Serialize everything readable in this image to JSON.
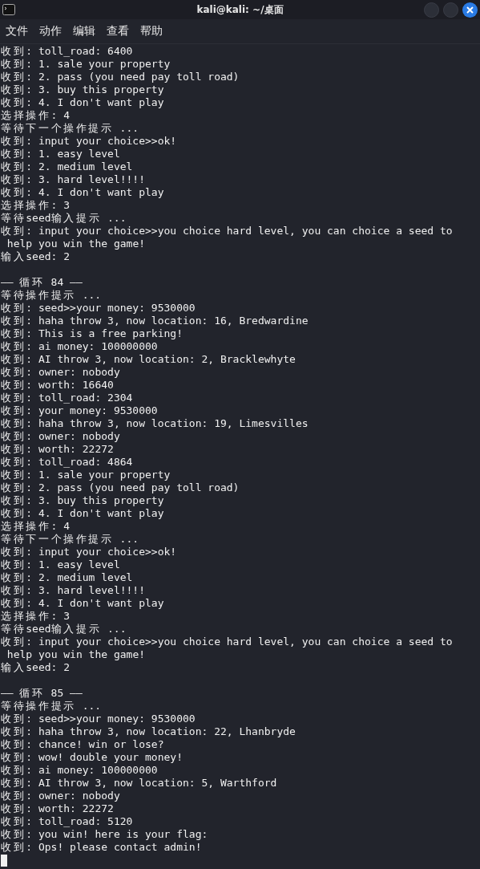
{
  "window": {
    "title": "kali@kali: ~/桌面"
  },
  "menu": [
    "文件",
    "动作",
    "编辑",
    "查看",
    "帮助"
  ],
  "terminal": {
    "blocks": [
      [
        "收到: toll_road: 6400",
        "收到: 1. sale your property",
        "收到: 2. pass (you need pay toll road)",
        "收到: 3. buy this property",
        "收到: 4. I don't want play",
        "选择操作: 4",
        "等待下一个操作提示 ...",
        "收到: input your choice>>ok!",
        "收到: 1. easy level",
        "收到: 2. medium level",
        "收到: 3. hard level!!!!",
        "收到: 4. I don't want play",
        "选择操作: 3",
        "等待seed输入提示 ...",
        "收到: input your choice>>you choice hard level, you can choice a seed to",
        " help you win the game!",
        "输入seed: 2"
      ],
      [
        "—— 循环 84 ——",
        "等待操作提示 ...",
        "收到: seed>>your money: 9530000",
        "收到: haha throw 3, now location: 16, Bredwardine",
        "收到: This is a free parking!",
        "收到: ai money: 100000000",
        "收到: AI throw 3, now location: 2, Bracklewhyte",
        "收到: owner: nobody",
        "收到: worth: 16640",
        "收到: toll_road: 2304",
        "收到: your money: 9530000",
        "收到: haha throw 3, now location: 19, Limesvilles",
        "收到: owner: nobody",
        "收到: worth: 22272",
        "收到: toll_road: 4864",
        "收到: 1. sale your property",
        "收到: 2. pass (you need pay toll road)",
        "收到: 3. buy this property",
        "收到: 4. I don't want play",
        "选择操作: 4",
        "等待下一个操作提示 ...",
        "收到: input your choice>>ok!",
        "收到: 1. easy level",
        "收到: 2. medium level",
        "收到: 3. hard level!!!!",
        "收到: 4. I don't want play",
        "选择操作: 3",
        "等待seed输入提示 ...",
        "收到: input your choice>>you choice hard level, you can choice a seed to",
        " help you win the game!",
        "输入seed: 2"
      ],
      [
        "—— 循环 85 ——",
        "等待操作提示 ...",
        "收到: seed>>your money: 9530000",
        "收到: haha throw 3, now location: 22, Lhanbryde",
        "收到: chance! win or lose?",
        "收到: wow! double your money!",
        "收到: ai money: 100000000",
        "收到: AI throw 3, now location: 5, Warthford",
        "收到: owner: nobody",
        "收到: worth: 22272",
        "收到: toll_road: 5120",
        "收到: you win! here is your flag:",
        "收到: Ops! please contact admin!"
      ]
    ]
  }
}
